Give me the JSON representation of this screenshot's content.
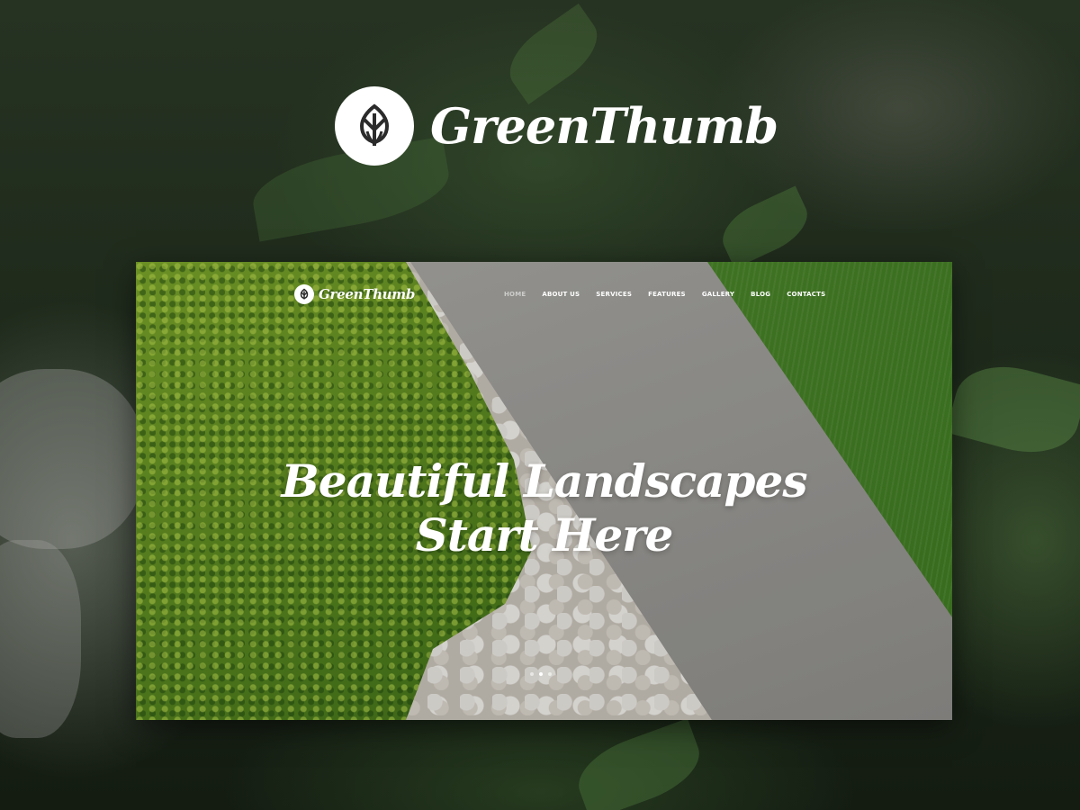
{
  "brand": {
    "name": "GreenThumb",
    "logo_icon": "tulip-icon"
  },
  "preview": {
    "brand_name": "GreenThumb",
    "logo_icon": "tulip-icon",
    "nav": {
      "items": [
        {
          "label": "HOME",
          "active": true
        },
        {
          "label": "ABOUT US",
          "active": false
        },
        {
          "label": "SERVICES",
          "active": false
        },
        {
          "label": "FEATURES",
          "active": false
        },
        {
          "label": "GALLERY",
          "active": false
        },
        {
          "label": "BLOG",
          "active": false
        },
        {
          "label": "CONTACTS",
          "active": false
        }
      ]
    },
    "hero": {
      "line1": "Beautiful Landscapes",
      "line2": "Start Here"
    },
    "slider": {
      "slide_count": 3,
      "active_index": 1
    }
  },
  "colors": {
    "logo_fill": "#ffffff",
    "logo_mark": "#2b2b2b",
    "nav_active": "#ffffffa0"
  }
}
